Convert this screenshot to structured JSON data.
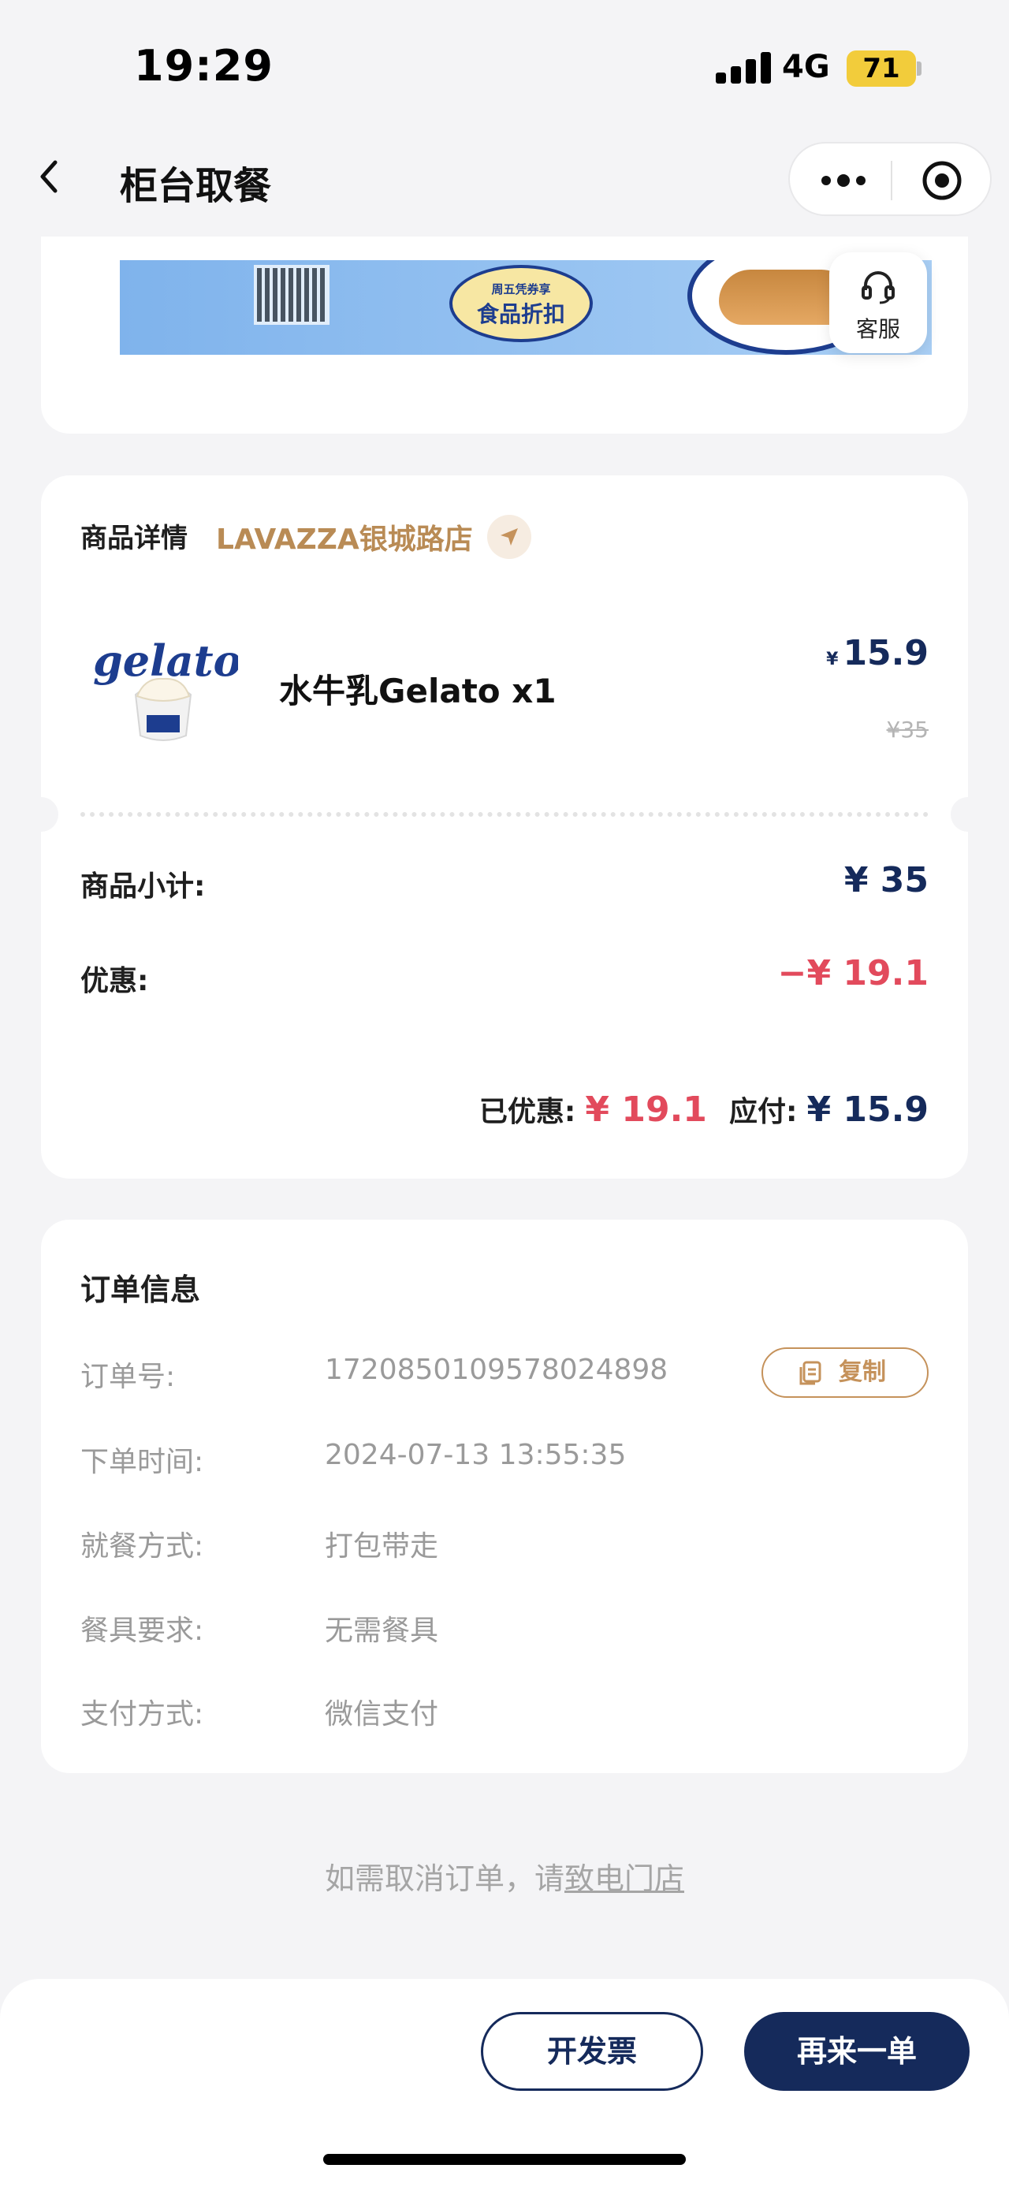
{
  "status_bar": {
    "time": "19:29",
    "network": "4G",
    "battery": "71"
  },
  "nav": {
    "title": "柜台取餐"
  },
  "banner": {
    "promo_line1": "周五凭券享",
    "promo_line2": "食品折扣"
  },
  "customer_service": {
    "label": "客服"
  },
  "goods": {
    "heading": "商品详情",
    "store_name": "LAVAZZA银城路店",
    "product": {
      "name": "水牛乳Gelato x1",
      "price_symbol": "¥",
      "price_now": "15.9",
      "price_original": "¥35",
      "image_brand_text": "gelato"
    },
    "subtotal_label": "商品小计:",
    "subtotal_value": "¥ 35",
    "discount_label": "优惠:",
    "discount_value": "−¥ 19.1",
    "saved_label": "已优惠:",
    "saved_value": "¥ 19.1",
    "payable_label": "应付:",
    "payable_value": "¥ 15.9"
  },
  "order_info": {
    "title": "订单信息",
    "rows": [
      {
        "label": "订单号:",
        "value": "17208501095780248​98"
      },
      {
        "label": "下单时间:",
        "value": "2024-07-13 13:55:35"
      },
      {
        "label": "就餐方式:",
        "value": "打包带走"
      },
      {
        "label": "餐具要求:",
        "value": "无需餐具"
      },
      {
        "label": "支付方式:",
        "value": "微信支付"
      }
    ],
    "copy_label": "复制"
  },
  "cancel_note": {
    "text": "如需取消订单，请",
    "link": "致电门店"
  },
  "bottom": {
    "invoice_label": "开发票",
    "reorder_label": "再来一单"
  },
  "colors": {
    "navy": "#152a5b",
    "discount_red": "#e24a5c",
    "store_gold": "#b98b55"
  }
}
